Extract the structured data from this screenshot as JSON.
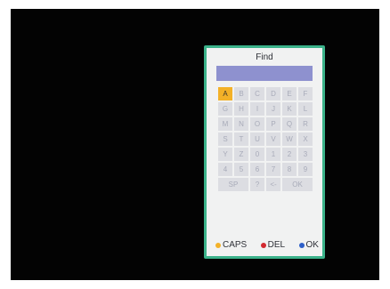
{
  "dialog": {
    "title": "Find",
    "input_value": ""
  },
  "keyboard": {
    "selected": "A",
    "rows": [
      [
        "A",
        "B",
        "C",
        "D",
        "E",
        "F"
      ],
      [
        "G",
        "H",
        "I",
        "J",
        "K",
        "L"
      ],
      [
        "M",
        "N",
        "O",
        "P",
        "Q",
        "R"
      ],
      [
        "S",
        "T",
        "U",
        "V",
        "W",
        "X"
      ],
      [
        "Y",
        "Z",
        "0",
        "1",
        "2",
        "3"
      ],
      [
        "4",
        "5",
        "6",
        "7",
        "8",
        "9"
      ],
      [
        "SP",
        "?",
        "<-",
        "OK"
      ]
    ]
  },
  "legend": {
    "caps": {
      "label": "CAPS",
      "color": "#f3b128",
      "icon": "yellow-dot-icon"
    },
    "del": {
      "label": "DEL",
      "color": "#d22a30",
      "icon": "red-dot-icon"
    },
    "ok": {
      "label": "OK",
      "color": "#2d5fc8",
      "icon": "blue-dot-icon"
    }
  },
  "colors": {
    "screen_background": "#030303",
    "dialog_border": "#3bb28a",
    "dialog_background": "#f1f2f2",
    "input_background": "#8e91cf",
    "key_background": "#dcdde2",
    "key_text": "#a8abb9",
    "key_selected": "#f3b128"
  }
}
